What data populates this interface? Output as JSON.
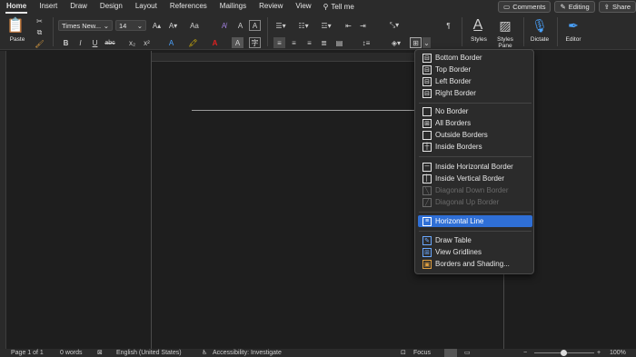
{
  "tabs": [
    "Home",
    "Insert",
    "Draw",
    "Design",
    "Layout",
    "References",
    "Mailings",
    "Review",
    "View"
  ],
  "active_tab": "Home",
  "tell_me": "Tell me",
  "top_buttons": {
    "comments": "Comments",
    "editing": "Editing",
    "share": "Share"
  },
  "ribbon": {
    "paste_label": "Paste",
    "font_name": "Times New...",
    "font_size": "14",
    "styles_label": "Styles",
    "styles_pane_label": "Styles Pane",
    "dictate_label": "Dictate",
    "editor_label": "Editor",
    "bold": "B",
    "italic": "I",
    "underline": "U",
    "strike": "abc",
    "subscript": "x₂",
    "superscript": "x²",
    "case": "Aa",
    "clear": "A"
  },
  "menu": {
    "group1": [
      "Bottom Border",
      "Top Border",
      "Left Border",
      "Right Border"
    ],
    "group2": [
      "No Border",
      "All Borders",
      "Outside Borders",
      "Inside Borders"
    ],
    "group3": [
      "Inside Horizontal Border",
      "Inside Vertical Border",
      "Diagonal Down Border",
      "Diagonal Up Border"
    ],
    "selected": "Horizontal Line",
    "group5": [
      "Draw Table",
      "View Gridlines",
      "Borders and Shading..."
    ]
  },
  "status": {
    "page": "Page 1 of 1",
    "words": "0 words",
    "language": "English (United States)",
    "accessibility": "Accessibility: Investigate",
    "focus": "Focus",
    "zoom": "100%"
  },
  "colors": {
    "accent": "#2f6fd6",
    "highlight": "#ffd400",
    "font_color": "#e02020"
  }
}
